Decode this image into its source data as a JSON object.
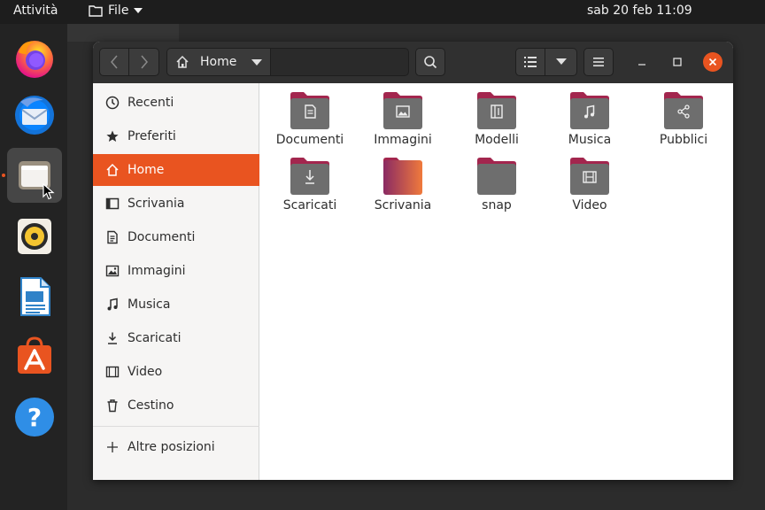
{
  "topbar": {
    "activities": "Attività",
    "app_menu_label": "File",
    "clock": "sab 20 feb  11:09"
  },
  "dock": {
    "items": [
      {
        "name": "firefox-icon"
      },
      {
        "name": "thunderbird-icon"
      },
      {
        "name": "files-icon",
        "active": true
      },
      {
        "name": "rhythmbox-icon"
      },
      {
        "name": "libreoffice-writer-icon"
      },
      {
        "name": "ubuntu-software-icon"
      },
      {
        "name": "help-icon"
      }
    ]
  },
  "window": {
    "path": {
      "current": "Home"
    },
    "sidebar": {
      "items": [
        {
          "label": "Recenti",
          "icon": "clock-icon"
        },
        {
          "label": "Preferiti",
          "icon": "star-icon"
        },
        {
          "label": "Home",
          "icon": "home-icon",
          "selected": true
        },
        {
          "label": "Scrivania",
          "icon": "desktop-icon"
        },
        {
          "label": "Documenti",
          "icon": "document-icon"
        },
        {
          "label": "Immagini",
          "icon": "image-icon"
        },
        {
          "label": "Musica",
          "icon": "music-icon"
        },
        {
          "label": "Scaricati",
          "icon": "download-icon"
        },
        {
          "label": "Video",
          "icon": "video-icon"
        },
        {
          "label": "Cestino",
          "icon": "trash-icon"
        }
      ],
      "other_locations": "Altre posizioni"
    },
    "files": [
      {
        "label": "Documenti",
        "emblem": "document"
      },
      {
        "label": "Immagini",
        "emblem": "image"
      },
      {
        "label": "Modelli",
        "emblem": "template"
      },
      {
        "label": "Musica",
        "emblem": "music"
      },
      {
        "label": "Pubblici",
        "emblem": "share"
      },
      {
        "label": "Scaricati",
        "emblem": "download"
      },
      {
        "label": "Scrivania",
        "emblem": "desktop"
      },
      {
        "label": "snap",
        "emblem": "none"
      },
      {
        "label": "Video",
        "emblem": "video"
      }
    ]
  },
  "colors": {
    "accent": "#e95420",
    "folder_tab": "#a3264e",
    "folder_body": "#6e6e6e"
  }
}
